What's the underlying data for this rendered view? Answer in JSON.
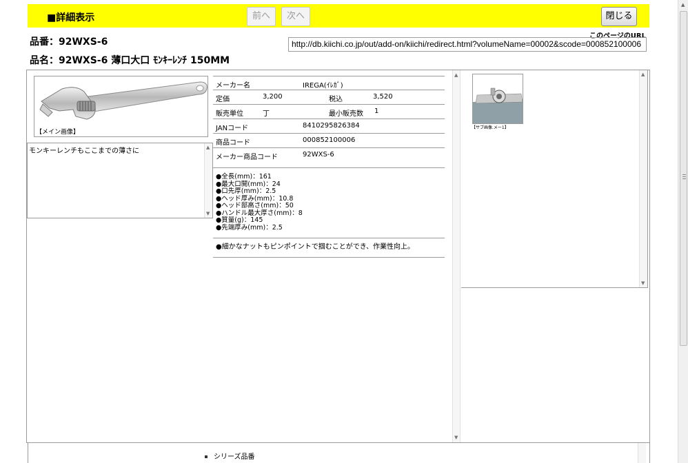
{
  "header": {
    "title": "■詳細表示",
    "prev_label": "前へ",
    "next_label": "次へ",
    "close_label": "閉じる"
  },
  "product": {
    "hinban_label": "品番：92WXS-6",
    "hinmei_label": "品名：92WXS-6 薄口大口 ﾓﾝｷｰﾚﾝﾁ 150MM"
  },
  "url": {
    "label": "このページのURL",
    "value": "http://db.kiichi.co.jp/out/add-on/kiichi/redirect.html?volumeName=00002&scode=000852100006"
  },
  "main_image": {
    "caption": "【メイン画像】",
    "icon": "wrench-icon"
  },
  "description": {
    "text": "モンキーレンチもここまでの薄さに"
  },
  "spec": {
    "maker_label": "メーカー名",
    "maker_value": "IREGA(ｲﾚｶﾞ)",
    "price_label": "定価",
    "price_value": "3,200",
    "tax_label": "税込",
    "tax_value": "3,520",
    "unit_label": "販売単位",
    "unit_value": "丁",
    "min_label": "最小販売数",
    "min_value": "1",
    "jan_label": "JANコード",
    "jan_value": "8410295826384",
    "code_label": "商品コード",
    "code_value": "000852100006",
    "maker_code_label": "メーカー商品コード",
    "maker_code_value": "92WXS-6"
  },
  "features": [
    "●全長(mm)：161",
    "●最大口開(mm)：24",
    "●口先厚(mm)：2.5",
    "●ヘッド厚み(mm)：10.8",
    "●ヘッド部高さ(mm)：50",
    "●ハンドル最大厚さ(mm)：8",
    "●質量(g)：145",
    "●先端厚み(mm)：2.5"
  ],
  "notes": "●細かなナットもピンポイントで掴むことができ、作業性向上。",
  "sub_image": {
    "caption": "【サブ画像.メー1】"
  },
  "bottom": {
    "series_label": "シリーズ品番"
  }
}
